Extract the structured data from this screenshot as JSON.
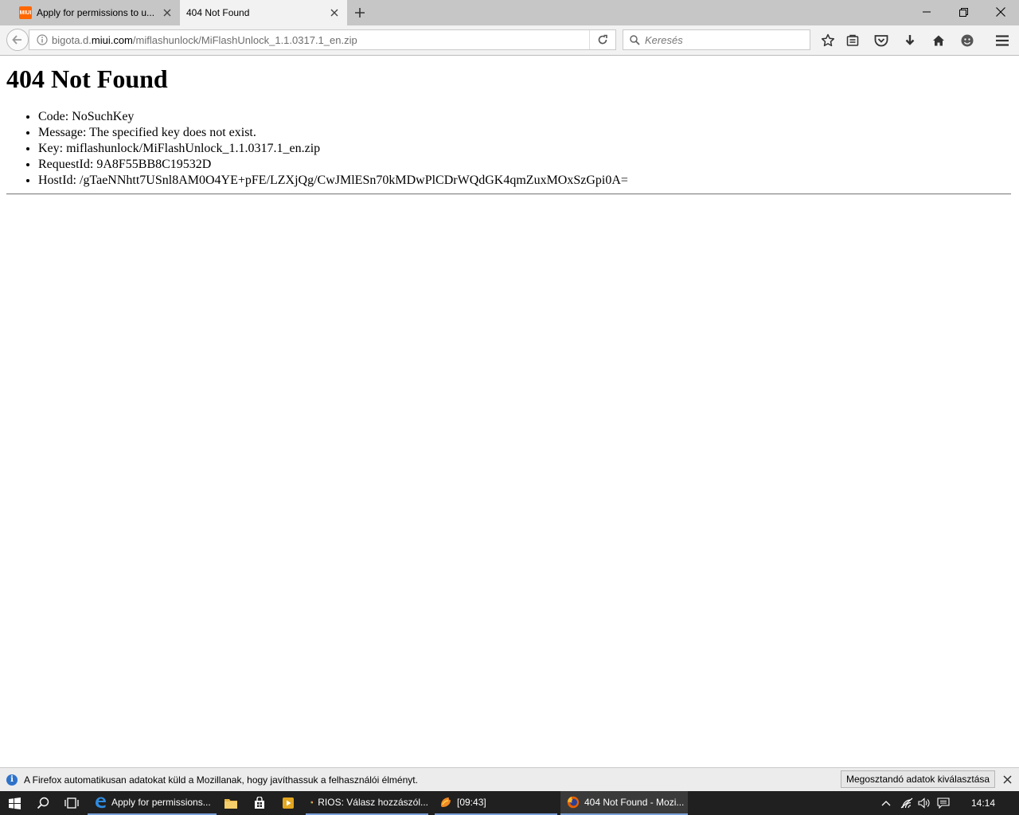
{
  "tabs": [
    {
      "title": "Apply for permissions to u...",
      "favicon": "MIUI"
    },
    {
      "title": "404 Not Found"
    }
  ],
  "navbar": {
    "url_prefix": "bigota.d.",
    "url_domain": "miui.com",
    "url_path": "/miflashunlock/MiFlashUnlock_1.1.0317.1_en.zip",
    "search_placeholder": "Keresés"
  },
  "page": {
    "heading": "404 Not Found",
    "items": [
      "Code: NoSuchKey",
      "Message: The specified key does not exist.",
      "Key: miflashunlock/MiFlashUnlock_1.1.0317.1_en.zip",
      "RequestId: 9A8F55BB8C19532D",
      "HostId: /gTaeNNhtt7USnl8AM0O4YE+pFE/LZXjQg/CwJMlESn70kMDwPlCDrWQdGK4qmZuxMOxSzGpi0A="
    ]
  },
  "notification": {
    "text": "A Firefox automatikusan adatokat küld a Mozillanak, hogy javíthassuk a felhasználói élményt.",
    "button": "Megosztandó adatok kiválasztása"
  },
  "taskbar": {
    "items": [
      {
        "label": "Apply for permissions..."
      },
      {
        "label": "RIOS: Válasz hozzászól..."
      },
      {
        "label": "[09:43]"
      },
      {
        "label": "404 Not Found - Mozi..."
      }
    ],
    "clock": "14:14"
  },
  "colors": {
    "accent": "#2f72c9",
    "miui": "#ff6700"
  }
}
